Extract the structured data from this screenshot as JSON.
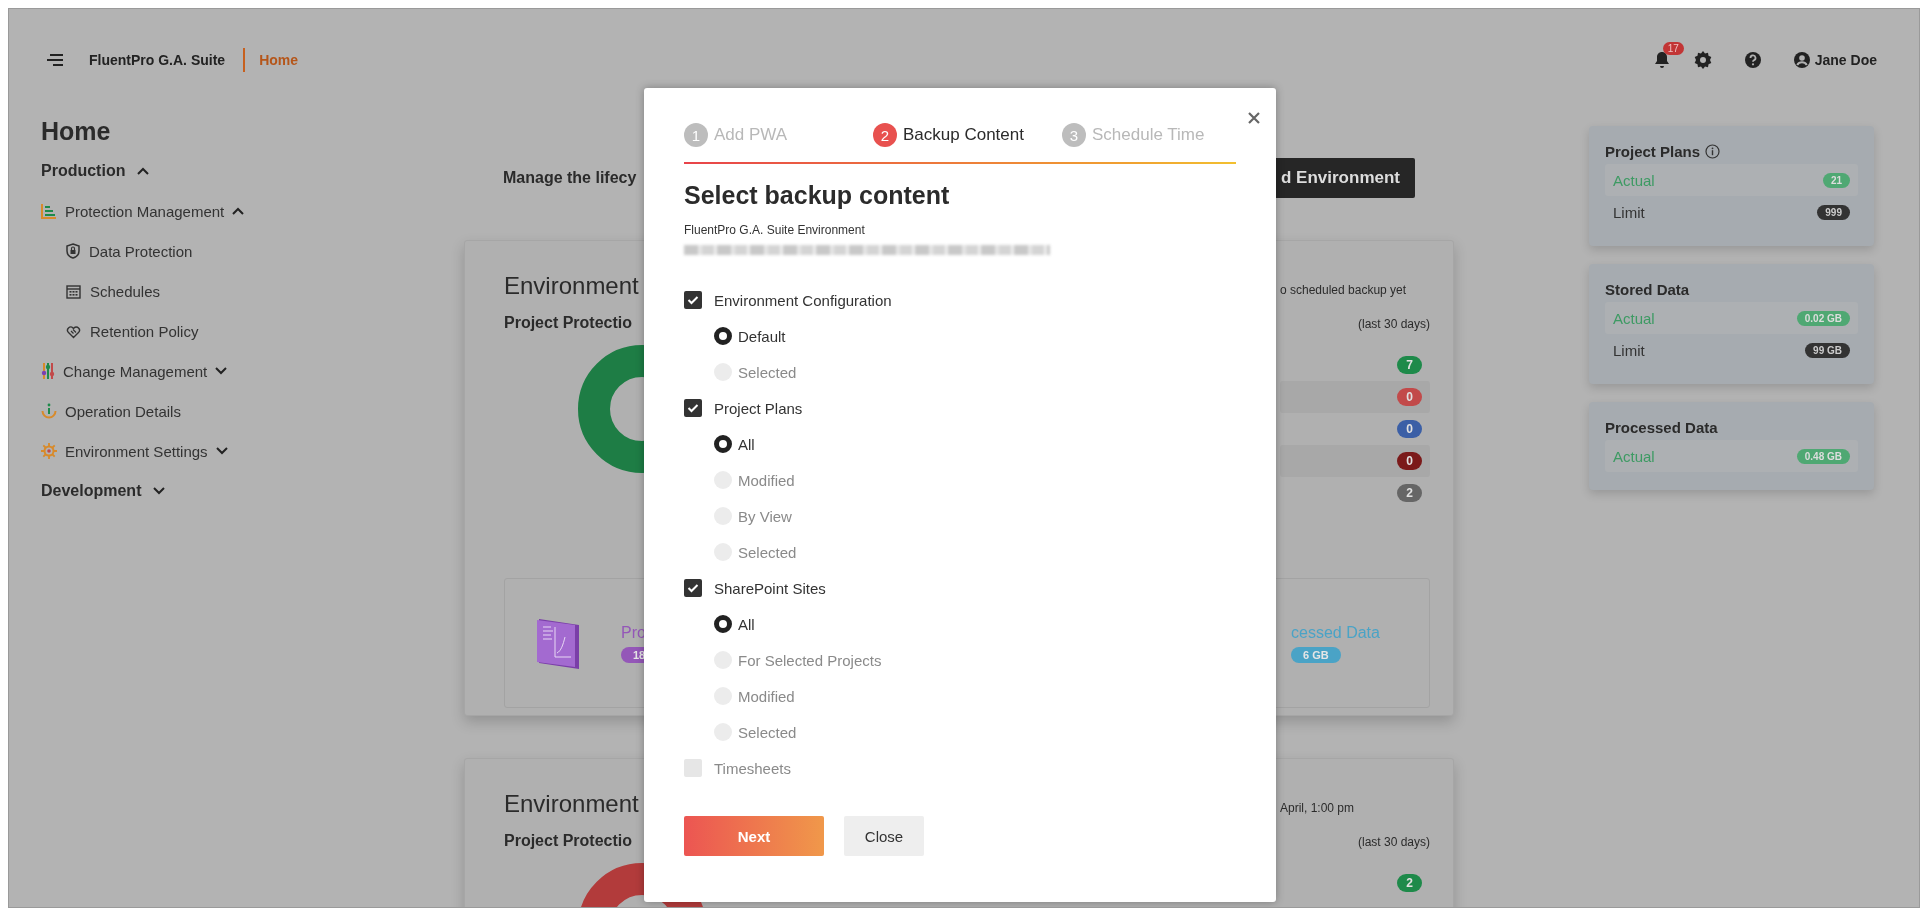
{
  "header": {
    "app_name": "FluentPro G.A. Suite",
    "current_page": "Home",
    "notification_count": "17",
    "user_name": "Jane Doe"
  },
  "sidebar": {
    "title": "Home",
    "sections": [
      {
        "label": "Production",
        "expanded": true,
        "children": [
          {
            "label": "Protection Management",
            "expanded": true,
            "children": [
              {
                "label": "Data Protection"
              },
              {
                "label": "Schedules"
              },
              {
                "label": "Retention Policy"
              }
            ]
          },
          {
            "label": "Change Management",
            "expanded": false
          },
          {
            "label": "Operation Details"
          },
          {
            "label": "Environment Settings",
            "expanded": false
          }
        ]
      },
      {
        "label": "Development",
        "expanded": false
      }
    ]
  },
  "main": {
    "intro": "Manage the lifecy",
    "add_button": "d Environment",
    "environments": [
      {
        "title": "Environment",
        "subtitle": "Project Protectio",
        "schedule_note": "o scheduled backup yet",
        "period": "(last 30 days)",
        "counts": [
          {
            "value": "7",
            "color": "#1e8a4a"
          },
          {
            "value": "0",
            "color": "#c24a4a"
          },
          {
            "value": "0",
            "color": "#3b5fa6"
          },
          {
            "value": "0",
            "color": "#7b1a1a"
          },
          {
            "value": "2",
            "color": "#666666"
          }
        ],
        "tiles": [
          {
            "label": "Pro",
            "value": "18",
            "color": "#9457b8"
          },
          {
            "label": "cessed Data",
            "value": "6 GB",
            "color": "#4aa3c6"
          }
        ]
      },
      {
        "title": "Environment",
        "subtitle": "Project Protectio",
        "schedule_note": "April, 1:00 pm",
        "period": "(last 30 days)",
        "counts": [
          {
            "value": "2",
            "color": "#1e8a4a"
          }
        ]
      }
    ]
  },
  "usage_panels": [
    {
      "title": "Project Plans",
      "info": true,
      "rows": [
        {
          "label": "Actual",
          "value": "21",
          "kind": "actual"
        },
        {
          "label": "Limit",
          "value": "999",
          "kind": "limit"
        }
      ]
    },
    {
      "title": "Stored Data",
      "info": false,
      "rows": [
        {
          "label": "Actual",
          "value": "0.02 GB",
          "kind": "actual"
        },
        {
          "label": "Limit",
          "value": "99 GB",
          "kind": "limit"
        }
      ]
    },
    {
      "title": "Processed Data",
      "info": false,
      "rows": [
        {
          "label": "Actual",
          "value": "0.48 GB",
          "kind": "actual"
        }
      ]
    }
  ],
  "dialog": {
    "steps": [
      {
        "number": "1",
        "label": "Add PWA",
        "selected": false
      },
      {
        "number": "2",
        "label": "Backup Content",
        "selected": true
      },
      {
        "number": "3",
        "label": "Schedule Time",
        "selected": false
      }
    ],
    "title": "Select backup content",
    "environment_label": "FluentPro G.A. Suite Environment",
    "options": [
      {
        "label": "Environment Configuration",
        "checked": true,
        "choices": [
          {
            "label": "Default",
            "selected": true
          },
          {
            "label": "Selected",
            "selected": false
          }
        ]
      },
      {
        "label": "Project Plans",
        "checked": true,
        "choices": [
          {
            "label": "All",
            "selected": true
          },
          {
            "label": "Modified",
            "selected": false
          },
          {
            "label": "By View",
            "selected": false
          },
          {
            "label": "Selected",
            "selected": false
          }
        ]
      },
      {
        "label": "SharePoint Sites",
        "checked": true,
        "choices": [
          {
            "label": "All",
            "selected": true
          },
          {
            "label": "For Selected Projects",
            "selected": false
          },
          {
            "label": "Modified",
            "selected": false
          },
          {
            "label": "Selected",
            "selected": false
          }
        ]
      },
      {
        "label": "Timesheets",
        "checked": false
      }
    ],
    "buttons": [
      {
        "label": "Next",
        "kind": "primary"
      },
      {
        "label": "Close",
        "kind": "secondary"
      }
    ]
  }
}
